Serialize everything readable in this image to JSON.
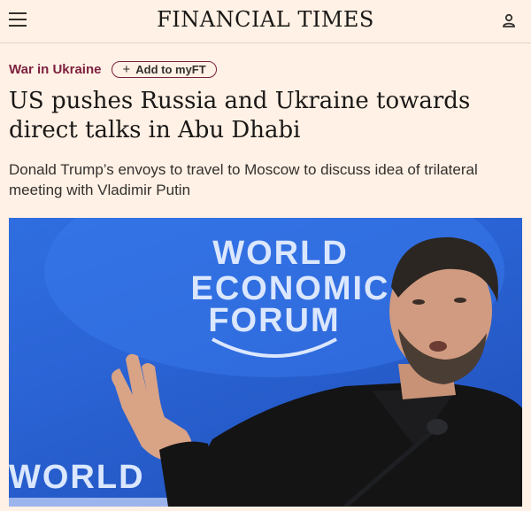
{
  "header": {
    "masthead": "FINANCIAL TIMES",
    "menu_icon": "hamburger-menu-icon",
    "account_icon": "user-account-icon"
  },
  "article": {
    "topic": "War in Ukraine",
    "myft_button": "Add to myFT",
    "myft_icon": "plus-icon",
    "headline": "US pushes Russia and Ukraine towards direct talks in Abu Dhabi",
    "standfirst": "Donald Trump’s envoys to travel to Moscow to discuss idea of trilateral meeting with Vladimir Putin"
  },
  "hero_image": {
    "backdrop_text": [
      "WORLD",
      "ECONOMIC",
      "FORUM"
    ],
    "backdrop_lower_text": "WORLD"
  },
  "colors": {
    "background": "#fff1e5",
    "topic": "#7d1f3e",
    "backdrop_blue": "#2f6ee0"
  }
}
